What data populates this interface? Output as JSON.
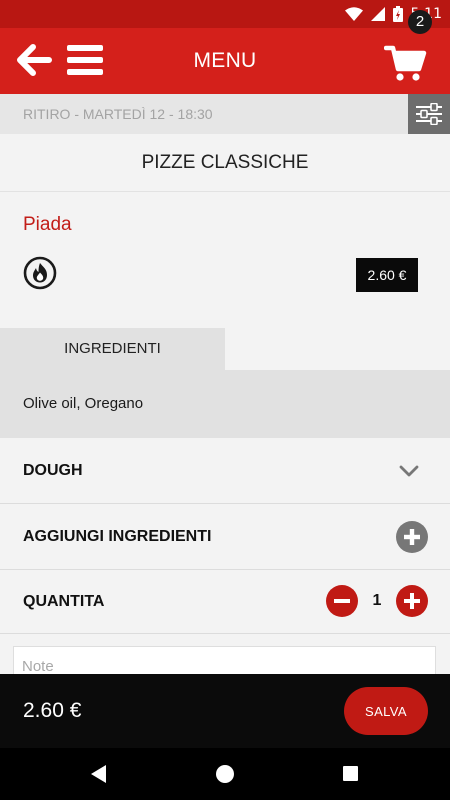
{
  "status_bar": {
    "time": "5:11"
  },
  "app_bar": {
    "title": "MENU",
    "cart_count": "2"
  },
  "pickup": {
    "label": "RITIRO - MARTEDÌ 12 - 18:30"
  },
  "category": {
    "title": "PIZZE CLASSICHE"
  },
  "product": {
    "name": "Piada",
    "price": "2.60 €",
    "badge_icon": "spicy-fire-icon"
  },
  "ingredients": {
    "tab_label": "INGREDIENTI",
    "text": "Olive oil, Oregano"
  },
  "options": {
    "dough_label": "DOUGH",
    "add_ingredients_label": "AGGIUNGI INGREDIENTI",
    "quantity_label": "QUANTITA",
    "quantity_value": "1"
  },
  "note": {
    "placeholder": "Note"
  },
  "footer": {
    "total": "2.60 €",
    "save_label": "SALVA"
  },
  "colors": {
    "brand_red": "#d4201b",
    "status_red": "#b81712",
    "accent_red": "#c01a14",
    "button_grey": "#6d6d6d"
  }
}
